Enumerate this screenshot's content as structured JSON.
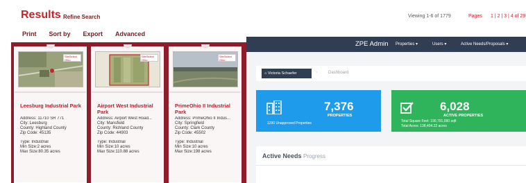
{
  "results": {
    "title": "Results",
    "refine_label": "Refine Search",
    "viewing_text": "Viewing 1-6 of 1779",
    "pages_label": "Pages",
    "pages_text": "1 | 2 | 3 | 4 of 29",
    "toolbar": {
      "print": "Print",
      "sort_by": "Sort by",
      "export": "Export",
      "advanced": "Advanced"
    },
    "logo_text": "SiteSelect Ohio",
    "cards": [
      {
        "name": "Leesburg Industrial Park",
        "address": "Address: 11710 SR 771",
        "city": "City: Leesburg",
        "county": "County: Highland County",
        "zip": "Zip Code: 45135",
        "type": "Type: Industrial",
        "min_size": "Min Size:2 acres",
        "max_size": "Max Size:80.35 acres"
      },
      {
        "name": "Airport West Industrial Park",
        "address": "Address: Airport West Road...",
        "city": "City: Mansfield",
        "county": "County: Richland County",
        "zip": "Zip Code: 44903",
        "type": "Type: Industrial",
        "min_size": "Min Size:10 acres",
        "max_size": "Max Size:110.88 acres"
      },
      {
        "name": "PrimeOhio II Industrial Park",
        "address": "Address: PrimeOhio II Indus...",
        "city": "City: Springfield",
        "county": "County: Clark County",
        "zip": "Zip Code: 45502",
        "type": "Type: Industrial",
        "min_size": "Min Size:10 acres",
        "max_size": "Max Size:198 acres"
      }
    ]
  },
  "admin": {
    "brand": "ZPE Admin",
    "nav": {
      "properties": "Properties ▾",
      "users": "Users ▾",
      "active_needs": "Active Needs/Proposals ▾"
    },
    "breadcrumb": {
      "user": "Victoria Schaefer",
      "current": "Dashboard"
    },
    "stats": {
      "properties_count": "7,376",
      "properties_label": "PROPERTIES",
      "unapproved": "1290 Unapproved Properties",
      "active_count": "6,028",
      "active_label": "ACTIVE PROPERTIES",
      "total_square_feet": "Total Square Feet: 190,791,090 sqft",
      "total_acres": "Total Acres: 138,404.22 acres"
    },
    "needs": {
      "title": "Active Needs",
      "subtitle": "Progress"
    },
    "colors": {
      "navbar": "#2f3e53",
      "blue_card": "#1e9bea",
      "green_card": "#2fb45c",
      "maroon": "#8e1d2b",
      "accent_red": "#c0262c"
    }
  }
}
